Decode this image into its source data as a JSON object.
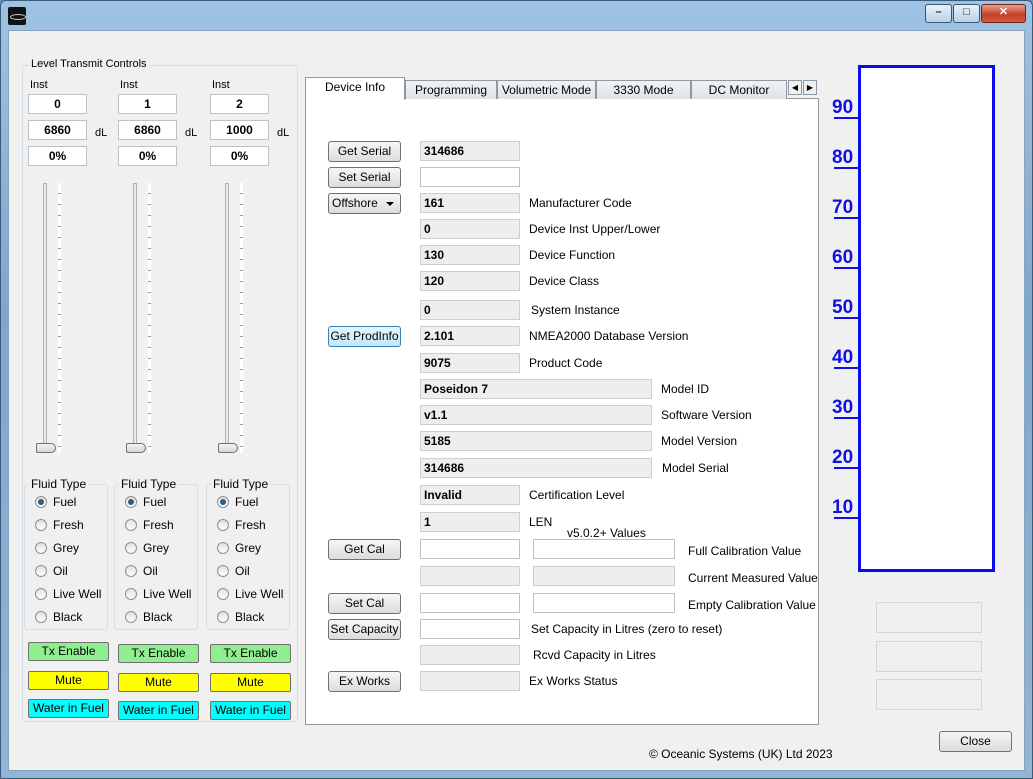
{
  "window": {
    "minimize_label": "–",
    "maximize_label": "□",
    "close_label": "✕"
  },
  "level_controls": {
    "title": "Level Transmit Controls",
    "unit_label": "dL",
    "channels": [
      {
        "inst_label": "Inst",
        "inst": "0",
        "value": "6860",
        "percent": "0%",
        "level": 0.0,
        "fluid_type_label": "Fluid Type",
        "selected": "Fuel",
        "tx_enable": "Tx Enable",
        "mute": "Mute",
        "water_in_fuel": "Water in Fuel"
      },
      {
        "inst_label": "Inst",
        "inst": "1",
        "value": "6860",
        "percent": "0%",
        "level": 0.0,
        "fluid_type_label": "Fluid Type",
        "selected": "Fuel",
        "tx_enable": "Tx Enable",
        "mute": "Mute",
        "water_in_fuel": "Water in Fuel"
      },
      {
        "inst_label": "Inst",
        "inst": "2",
        "value": "1000",
        "percent": "0%",
        "level": 0.0,
        "fluid_type_label": "Fluid Type",
        "selected": "Fuel",
        "tx_enable": "Tx Enable",
        "mute": "Mute",
        "water_in_fuel": "Water in Fuel"
      }
    ],
    "fluid_options": [
      "Fuel",
      "Fresh",
      "Grey",
      "Oil",
      "Live Well",
      "Black"
    ],
    "colors": {
      "tx_enable": "#90ee90",
      "mute": "#ffff00",
      "water_in_fuel": "#00ffff"
    }
  },
  "tabs": [
    "Device Info",
    "Programming",
    "Volumetric Mode",
    "3330 Mode",
    "DC Monitor"
  ],
  "active_tab": "Device Info",
  "tab_scroll": {
    "left": "◀",
    "right": "▶"
  },
  "device_info": {
    "get_serial": "Get Serial",
    "set_serial": "Set Serial",
    "serial_value": "314686",
    "set_serial_value": "",
    "offshore": "Offshore",
    "get_prodinfo": "Get ProdInfo",
    "fields": [
      {
        "value": "161",
        "label": "Manufacturer Code"
      },
      {
        "value": "0",
        "label": "Device Inst Upper/Lower"
      },
      {
        "value": "130",
        "label": "Device Function"
      },
      {
        "value": "120",
        "label": "Device Class"
      },
      {
        "value": "0",
        "label": "System Instance"
      },
      {
        "value": "2.101",
        "label": "NMEA2000 Database Version"
      },
      {
        "value": "9075",
        "label": "Product Code"
      }
    ],
    "wide_fields": [
      {
        "value": "Poseidon 7",
        "label": "Model ID"
      },
      {
        "value": "v1.1",
        "label": "Software Version"
      },
      {
        "value": "5185",
        "label": "Model Version"
      },
      {
        "value": "314686",
        "label": "Model Serial"
      }
    ],
    "cert_level": {
      "value": "Invalid",
      "label": "Certification Level"
    },
    "len": {
      "value": "1",
      "label": "LEN"
    },
    "v502_label": "v5.0.2+ Values",
    "get_cal": "Get Cal",
    "set_cal": "Set Cal",
    "set_capacity": "Set Capacity",
    "ex_works": "Ex Works",
    "full_cal_label": "Full Calibration Value",
    "current_measured_label": "Current Measured Value",
    "empty_cal_label": "Empty Calibration Value",
    "set_capacity_label": "Set Capacity in Litres (zero to reset)",
    "rcvd_capacity_label": "Rcvd Capacity in Litres",
    "ex_works_status_label": "Ex Works Status"
  },
  "gauge": {
    "labels": [
      "90",
      "80",
      "70",
      "60",
      "50",
      "40",
      "30",
      "20",
      "10"
    ],
    "color": "#1010e6"
  },
  "footer": {
    "copyright": "© Oceanic Systems (UK) Ltd 2023",
    "close": "Close"
  }
}
